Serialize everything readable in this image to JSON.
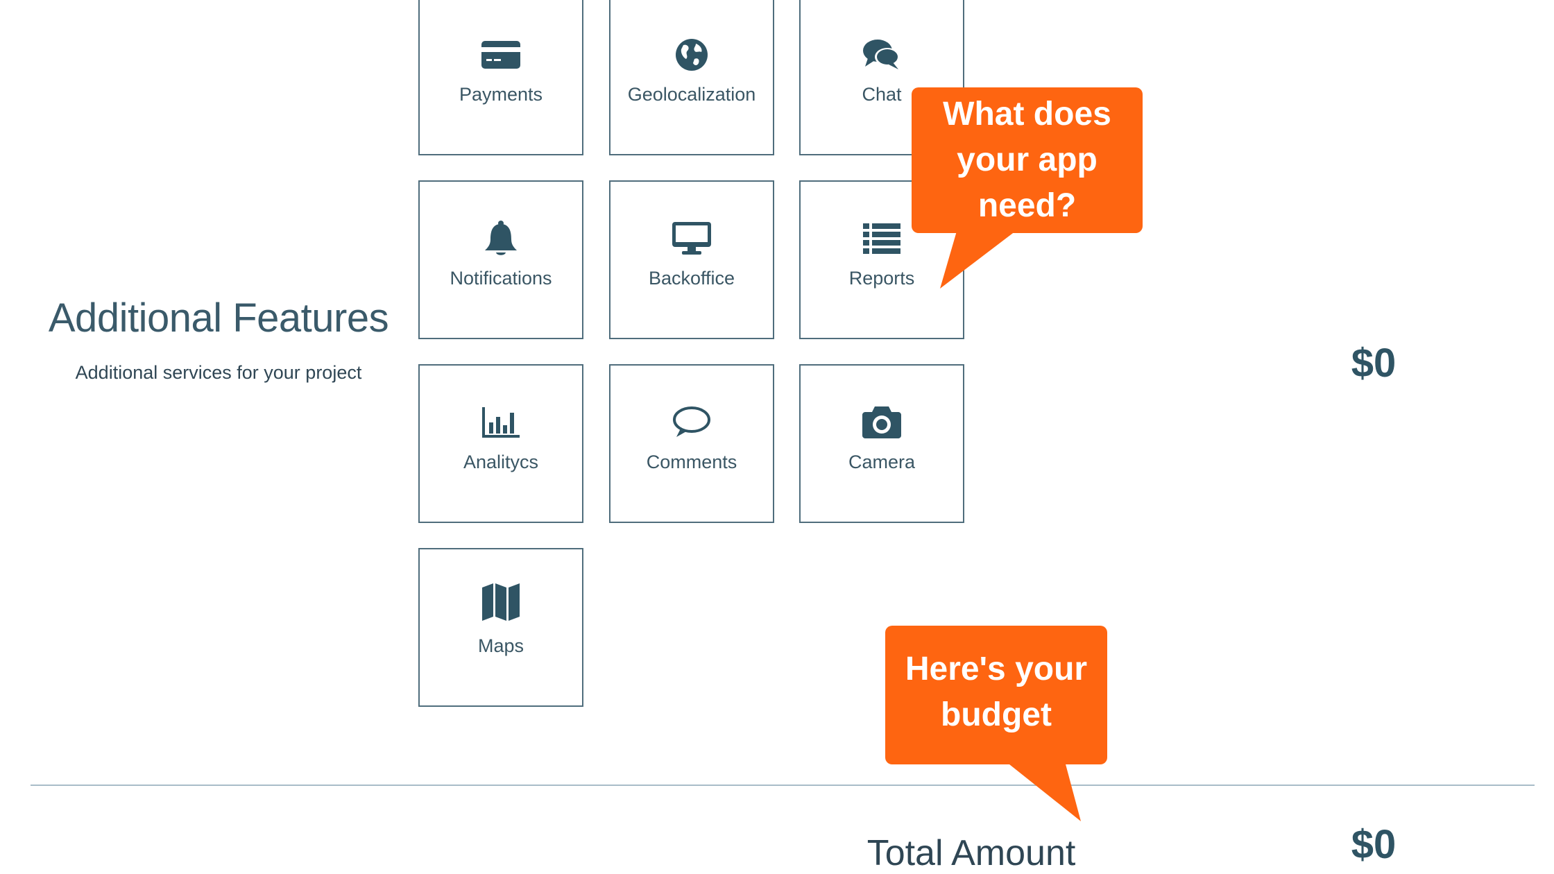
{
  "section": {
    "title": "Additional Features",
    "subtitle": "Additional services for your project",
    "price": "$0"
  },
  "features": [
    {
      "label": "Payments",
      "icon": "credit-card-icon"
    },
    {
      "label": "Geolocalization",
      "icon": "globe-icon"
    },
    {
      "label": "Chat",
      "icon": "chat-bubbles-icon"
    },
    {
      "label": "Notifications",
      "icon": "bell-icon"
    },
    {
      "label": "Backoffice",
      "icon": "monitor-icon"
    },
    {
      "label": "Reports",
      "icon": "list-icon"
    },
    {
      "label": "Analitycs",
      "icon": "bar-chart-icon"
    },
    {
      "label": "Comments",
      "icon": "speech-bubble-icon"
    },
    {
      "label": "Camera",
      "icon": "camera-icon"
    },
    {
      "label": "Maps",
      "icon": "map-icon"
    }
  ],
  "total": {
    "label": "Total Amount",
    "price": "$0"
  },
  "callouts": {
    "features": [
      "What does",
      "your app",
      "need?"
    ],
    "budget": [
      "Here's your",
      "budget"
    ]
  },
  "colors": {
    "accent": "#fe6511",
    "text": "#32505e",
    "tile_border": "#4f6d7c"
  }
}
